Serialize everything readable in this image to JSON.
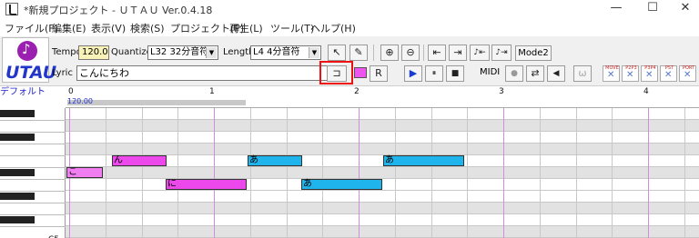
{
  "window": {
    "title": "*新規プロジェクト - ＵＴＡＵ Ver.0.4.18",
    "minimize": "—",
    "maximize": "☐",
    "close": "✕"
  },
  "menu": [
    "ファイル(F)",
    "編集(E)",
    "表示(V)",
    "検索(S)",
    "プロジェクト(P)",
    "再生(L)",
    "ツール(T)",
    "ヘルプ(H)"
  ],
  "logo": {
    "text": "UTAU"
  },
  "toolbar": {
    "tempo_label": "Tempo",
    "tempo_value": "120.0",
    "quantize_label": "Quantize",
    "quantize_value": "L32 32分音符",
    "length_label": "Length",
    "length_value": "L4 4分音符",
    "lyric_label": "Lyric",
    "lyric_value": "こんにちわ",
    "mode2": "Mode2",
    "midi_label": "MIDI",
    "icons": {
      "pointer": "↖",
      "pencil": "✎",
      "zoom_in": "⊕",
      "zoom_out": "⊖",
      "seek_start": "⇤",
      "seek_end": "⇥",
      "note_prev": "♪⇤",
      "note_next": "♪⇥",
      "insert_lyric": "⊐",
      "replace": "R",
      "play": "▶",
      "pause": "⏸",
      "stop": "■",
      "record": "●",
      "loop": "⇄",
      "speaker": "◀",
      "ties": "ω"
    },
    "fx_labels": [
      "MOVE",
      "P2P3",
      "P3P4",
      "PST",
      "PORT"
    ]
  },
  "roll": {
    "track_name": "デフォルト",
    "tempo_mark": "120.00",
    "measures": [
      "0",
      "1",
      "2",
      "3",
      "4"
    ],
    "key_label": "C5",
    "notes": [
      {
        "lyric": "こ",
        "measure": 0.0,
        "length": 0.25,
        "row": 5,
        "color": "lpink"
      },
      {
        "lyric": "ん",
        "measure": 0.3125,
        "length": 0.375,
        "row": 4,
        "color": "pink"
      },
      {
        "lyric": "に",
        "measure": 0.6875,
        "length": 0.5625,
        "row": 6,
        "color": "pink"
      },
      {
        "lyric": "あ",
        "measure": 1.25,
        "length": 0.375,
        "row": 4,
        "color": "cyan"
      },
      {
        "lyric": "あ",
        "measure": 1.625,
        "length": 0.5625,
        "row": 6,
        "color": "cyan"
      },
      {
        "lyric": "あ",
        "measure": 2.1875,
        "length": 0.5625,
        "row": 4,
        "color": "cyan"
      }
    ]
  }
}
